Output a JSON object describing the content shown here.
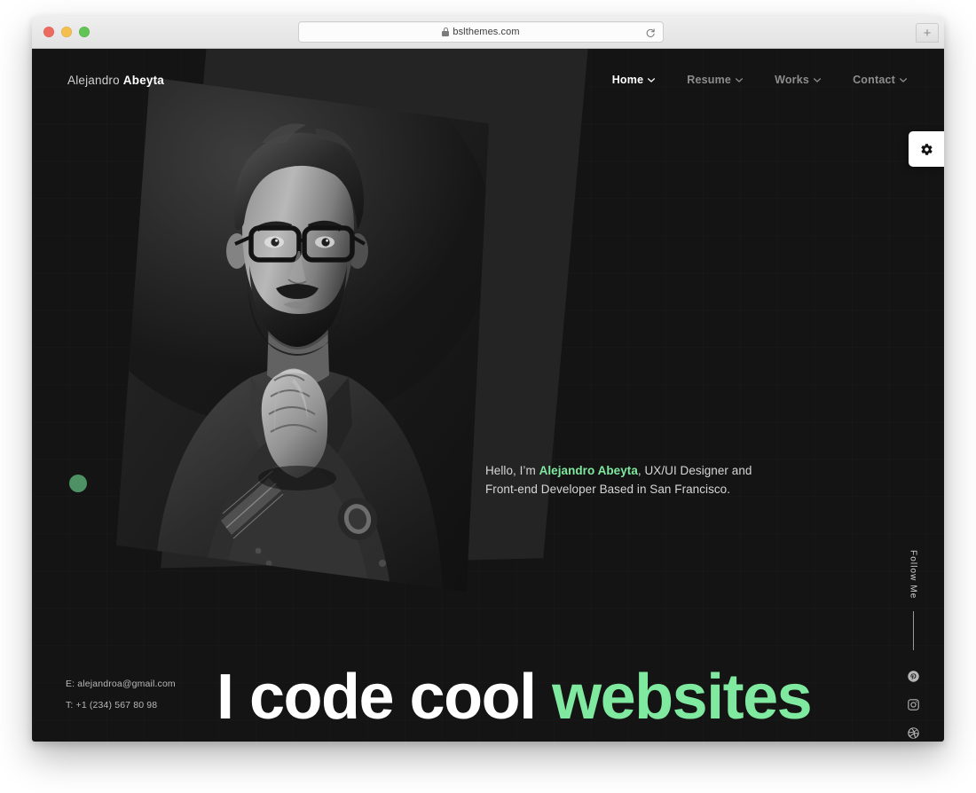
{
  "browser": {
    "url": "bslthemes.com",
    "lock_icon": "lock-icon",
    "reload_icon": "reload-icon",
    "new_tab_label": "+",
    "traffic_lights": [
      "close-red",
      "minimize-yellow",
      "zoom-green"
    ]
  },
  "site": {
    "logo": {
      "first_name": "Alejandro",
      "last_name": "Abeyta"
    },
    "nav": [
      {
        "label": "Home",
        "active": true,
        "icon": "chevron-down-icon"
      },
      {
        "label": "Resume",
        "active": false,
        "icon": "chevron-down-icon"
      },
      {
        "label": "Works",
        "active": false,
        "icon": "chevron-down-icon"
      },
      {
        "label": "Contact",
        "active": false,
        "icon": "chevron-down-icon"
      }
    ],
    "settings_button": {
      "icon": "gear-icon"
    },
    "intro": {
      "prefix": "Hello, I’m ",
      "name": "Alejandro Abeyta",
      "suffix": ", UX/UI Designer and Front-end Developer Based in San Francisco."
    },
    "headline": {
      "plain": "I code cool ",
      "accent": "websites"
    },
    "contact": {
      "email": "E: alejandroa@gmail.com",
      "phone": "T: +1 (234) 567 80 98"
    },
    "follow": {
      "label": "Follow Me",
      "socials": [
        {
          "name": "pinterest-icon"
        },
        {
          "name": "instagram-icon"
        },
        {
          "name": "dribbble-icon"
        }
      ]
    },
    "colors": {
      "background": "#141414",
      "panel": "#242424",
      "accent_green": "#7fe9a0",
      "dot_green": "#4d9165",
      "text_light": "#d6d6d6",
      "nav_inactive": "#8d8d8d"
    }
  }
}
